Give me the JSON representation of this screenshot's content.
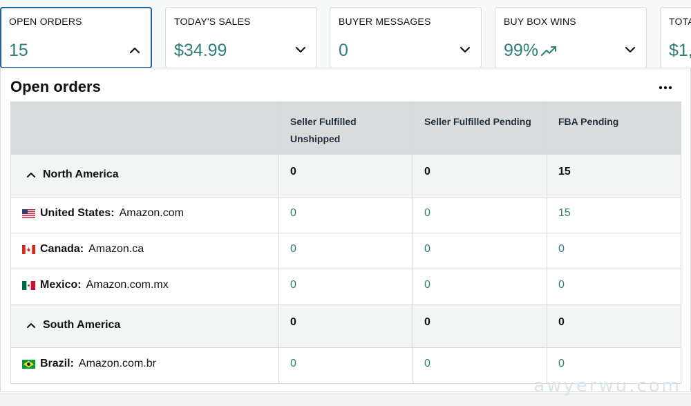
{
  "cards": [
    {
      "label": "OPEN ORDERS",
      "value": "15"
    },
    {
      "label": "TODAY'S SALES",
      "value": "$34.99"
    },
    {
      "label": "BUYER MESSAGES",
      "value": "0"
    },
    {
      "label": "BUY BOX WINS",
      "value": "99%"
    },
    {
      "label": "TOTA",
      "value": "$1,"
    }
  ],
  "panel": {
    "title": "Open orders",
    "columns": [
      "Seller Fulfilled Unshipped",
      "Seller Fulfilled Pending",
      "FBA Pending"
    ],
    "rows": [
      {
        "type": "region",
        "name": "North America",
        "values": [
          "0",
          "0",
          "15"
        ]
      },
      {
        "type": "market",
        "country": "United States:",
        "site": "Amazon.com",
        "flag": "us-flag",
        "values": [
          "0",
          "0",
          "15"
        ]
      },
      {
        "type": "market",
        "country": "Canada:",
        "site": "Amazon.ca",
        "flag": "canada-flag",
        "values": [
          "0",
          "0",
          "0"
        ]
      },
      {
        "type": "market",
        "country": "Mexico:",
        "site": "Amazon.com.mx",
        "flag": "mexico-flag",
        "values": [
          "0",
          "0",
          "0"
        ]
      },
      {
        "type": "region",
        "name": "South America",
        "values": [
          "0",
          "0",
          "0"
        ]
      },
      {
        "type": "market",
        "country": "Brazil:",
        "site": "Amazon.com.br",
        "flag": "brazil-flag",
        "values": [
          "0",
          "0",
          "0"
        ]
      }
    ]
  },
  "watermark": "awyerwu.com",
  "colors": {
    "accent": "#2d7e74",
    "active_border": "#2162a1",
    "header_bg": "#d8dcdc"
  }
}
